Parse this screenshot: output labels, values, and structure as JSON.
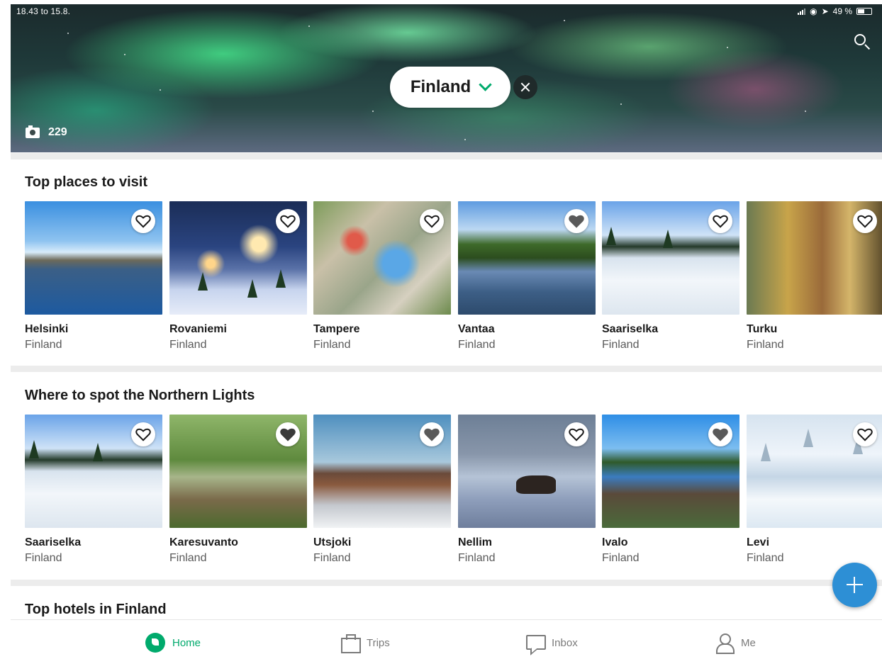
{
  "status_bar": {
    "left": "18.43  to 15.8.",
    "battery": "49 %"
  },
  "hero": {
    "location": "Finland",
    "photo_count": "229",
    "icons": [
      "search-icon",
      "chevron-down-icon",
      "close-icon",
      "camera-icon"
    ],
    "accent_color": "#00aa6c"
  },
  "sections": [
    {
      "title": "Top places to visit",
      "items": [
        {
          "name": "Helsinki",
          "country": "Finland"
        },
        {
          "name": "Rovaniemi",
          "country": "Finland"
        },
        {
          "name": "Tampere",
          "country": "Finland"
        },
        {
          "name": "Vantaa",
          "country": "Finland"
        },
        {
          "name": "Saariselka",
          "country": "Finland"
        },
        {
          "name": "Turku",
          "country": "Finland"
        }
      ]
    },
    {
      "title": "Where to spot the Northern Lights",
      "items": [
        {
          "name": "Saariselka",
          "country": "Finland"
        },
        {
          "name": "Karesuvanto",
          "country": "Finland"
        },
        {
          "name": "Utsjoki",
          "country": "Finland"
        },
        {
          "name": "Nellim",
          "country": "Finland"
        },
        {
          "name": "Ivalo",
          "country": "Finland"
        },
        {
          "name": "Levi",
          "country": "Finland"
        }
      ]
    },
    {
      "title": "Top hotels in Finland",
      "items": []
    }
  ],
  "fab": {
    "icon": "plus-icon",
    "color": "#2d8fd5"
  },
  "bottom_nav": {
    "items": [
      {
        "label": "Home",
        "icon": "compass-icon",
        "active": true
      },
      {
        "label": "Trips",
        "icon": "briefcase-icon",
        "active": false
      },
      {
        "label": "Inbox",
        "icon": "message-icon",
        "active": false
      },
      {
        "label": "Me",
        "icon": "person-icon",
        "active": false
      }
    ]
  }
}
